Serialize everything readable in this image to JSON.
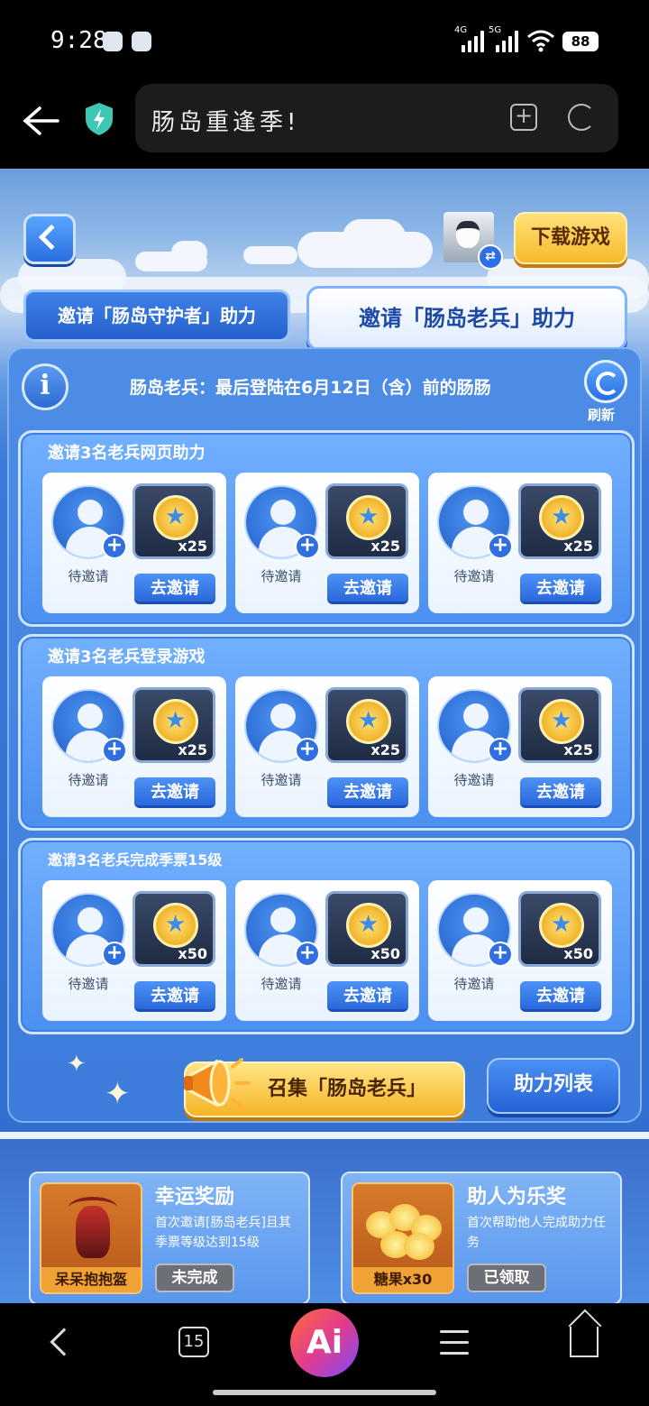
{
  "status_bar": {
    "time": "9:28",
    "signal1": "4G",
    "signal2": "5G",
    "battery": "88"
  },
  "browser": {
    "title": "肠岛重逢季!"
  },
  "header": {
    "download_label": "下载游戏"
  },
  "tabs": {
    "guardian": "邀请「肠岛守护者」助力",
    "veteran": "邀请「肠岛老兵」助力"
  },
  "notice": "肠岛老兵：最后登陆在6月12日（含）前的肠肠",
  "refresh_label": "刷新",
  "tasks": [
    {
      "title": "邀请3名老兵网页助力",
      "slots": [
        {
          "pending": "待邀请",
          "qty": "x25",
          "button": "去邀请"
        },
        {
          "pending": "待邀请",
          "qty": "x25",
          "button": "去邀请"
        },
        {
          "pending": "待邀请",
          "qty": "x25",
          "button": "去邀请"
        }
      ]
    },
    {
      "title": "邀请3名老兵登录游戏",
      "slots": [
        {
          "pending": "待邀请",
          "qty": "x25",
          "button": "去邀请"
        },
        {
          "pending": "待邀请",
          "qty": "x25",
          "button": "去邀请"
        },
        {
          "pending": "待邀请",
          "qty": "x25",
          "button": "去邀请"
        }
      ]
    },
    {
      "title": "邀请3名老兵完成季票15级",
      "slots": [
        {
          "pending": "待邀请",
          "qty": "x50",
          "button": "去邀请"
        },
        {
          "pending": "待邀请",
          "qty": "x50",
          "button": "去邀请"
        },
        {
          "pending": "待邀请",
          "qty": "x50",
          "button": "去邀请"
        }
      ]
    }
  ],
  "summon_label": "召集「肠岛老兵」",
  "assist_list_label": "助力列表",
  "cards": [
    {
      "title": "幸运奖励",
      "desc": "首次邀请[肠岛老兵]且其季票等级达到15级",
      "item": "呆呆抱抱盔",
      "status": "未完成"
    },
    {
      "title": "助人为乐奖",
      "desc": "首次帮助他人完成助力任务",
      "item": "糖果x30",
      "status": "已领取"
    }
  ],
  "nav": {
    "tabs_count": "15",
    "ai_label": "Ai"
  }
}
